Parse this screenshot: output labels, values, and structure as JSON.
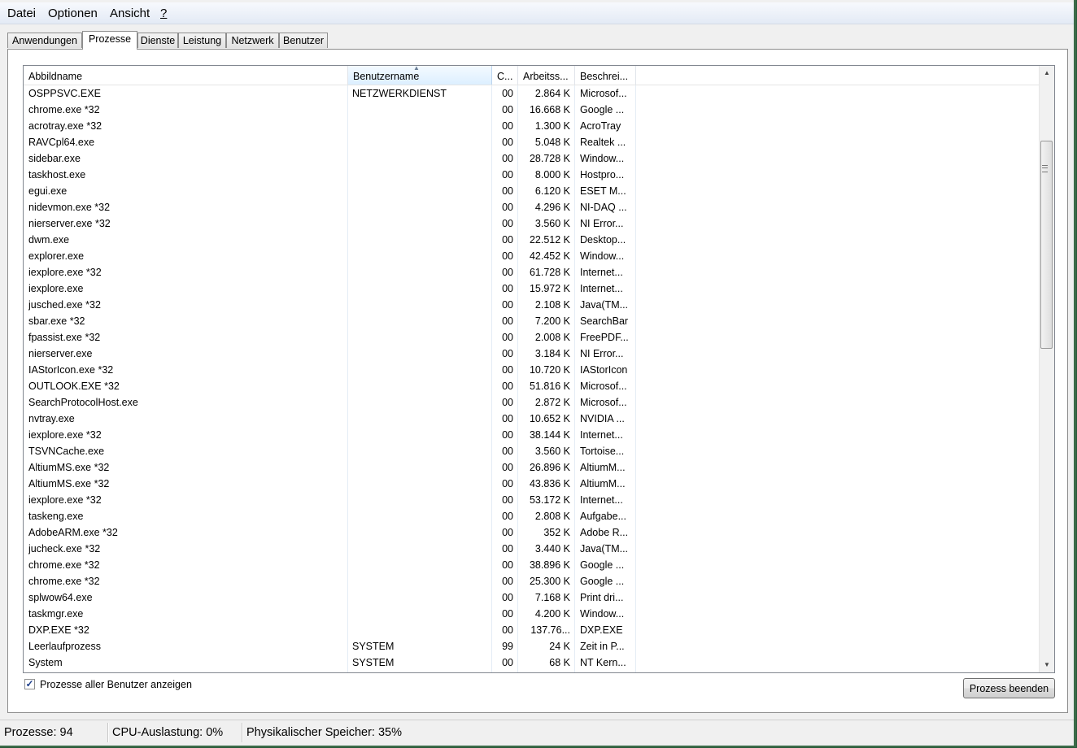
{
  "menu": [
    {
      "label": "Datei"
    },
    {
      "label": "Optionen"
    },
    {
      "label": "Ansicht"
    },
    {
      "label": "?"
    }
  ],
  "tabs": [
    {
      "label": "Anwendungen"
    },
    {
      "label": "Prozesse"
    },
    {
      "label": "Dienste"
    },
    {
      "label": "Leistung"
    },
    {
      "label": "Netzwerk"
    },
    {
      "label": "Benutzer"
    }
  ],
  "active_tab": "Prozesse",
  "columns": [
    {
      "label": "Abbildname"
    },
    {
      "label": "Benutzername"
    },
    {
      "label": "C..."
    },
    {
      "label": "Arbeitss..."
    },
    {
      "label": "Beschrei..."
    }
  ],
  "sorted_column": "Benutzername",
  "processes": [
    [
      "OSPPSVC.EXE",
      "NETZWERKDIENST",
      "00",
      "2.864 K",
      "Microsof..."
    ],
    [
      "chrome.exe *32",
      "",
      "00",
      "16.668 K",
      "Google ..."
    ],
    [
      "acrotray.exe *32",
      "",
      "00",
      "1.300 K",
      "AcroTray"
    ],
    [
      "RAVCpl64.exe",
      "",
      "00",
      "5.048 K",
      "Realtek ..."
    ],
    [
      "sidebar.exe",
      "",
      "00",
      "28.728 K",
      "Window..."
    ],
    [
      "taskhost.exe",
      "",
      "00",
      "8.000 K",
      "Hostpro..."
    ],
    [
      "egui.exe",
      "",
      "00",
      "6.120 K",
      "ESET M..."
    ],
    [
      "nidevmon.exe *32",
      "",
      "00",
      "4.296 K",
      "NI-DAQ ..."
    ],
    [
      "nierserver.exe *32",
      "",
      "00",
      "3.560 K",
      "NI Error..."
    ],
    [
      "dwm.exe",
      "",
      "00",
      "22.512 K",
      "Desktop..."
    ],
    [
      "explorer.exe",
      "",
      "00",
      "42.452 K",
      "Window..."
    ],
    [
      "iexplore.exe *32",
      "",
      "00",
      "61.728 K",
      "Internet..."
    ],
    [
      "iexplore.exe",
      "",
      "00",
      "15.972 K",
      "Internet..."
    ],
    [
      "jusched.exe *32",
      "",
      "00",
      "2.108 K",
      "Java(TM..."
    ],
    [
      "sbar.exe *32",
      "",
      "00",
      "7.200 K",
      "SearchBar"
    ],
    [
      "fpassist.exe *32",
      "",
      "00",
      "2.008 K",
      "FreePDF..."
    ],
    [
      "nierserver.exe",
      "",
      "00",
      "3.184 K",
      "NI Error..."
    ],
    [
      "IAStorIcon.exe *32",
      "",
      "00",
      "10.720 K",
      "IAStorIcon"
    ],
    [
      "OUTLOOK.EXE *32",
      "",
      "00",
      "51.816 K",
      "Microsof..."
    ],
    [
      "SearchProtocolHost.exe",
      "",
      "00",
      "2.872 K",
      "Microsof..."
    ],
    [
      "nvtray.exe",
      "",
      "00",
      "10.652 K",
      "NVIDIA ..."
    ],
    [
      "iexplore.exe *32",
      "",
      "00",
      "38.144 K",
      "Internet..."
    ],
    [
      "TSVNCache.exe",
      "",
      "00",
      "3.560 K",
      "Tortoise..."
    ],
    [
      "AltiumMS.exe *32",
      "",
      "00",
      "26.896 K",
      "AltiumM..."
    ],
    [
      "AltiumMS.exe *32",
      "",
      "00",
      "43.836 K",
      "AltiumM..."
    ],
    [
      "iexplore.exe *32",
      "",
      "00",
      "53.172 K",
      "Internet..."
    ],
    [
      "taskeng.exe",
      "",
      "00",
      "2.808 K",
      "Aufgabe..."
    ],
    [
      "AdobeARM.exe *32",
      "",
      "00",
      "352 K",
      "Adobe R..."
    ],
    [
      "jucheck.exe *32",
      "",
      "00",
      "3.440 K",
      "Java(TM..."
    ],
    [
      "chrome.exe *32",
      "",
      "00",
      "38.896 K",
      "Google ..."
    ],
    [
      "chrome.exe *32",
      "",
      "00",
      "25.300 K",
      "Google ..."
    ],
    [
      "splwow64.exe",
      "",
      "00",
      "7.168 K",
      "Print dri..."
    ],
    [
      "taskmgr.exe",
      "",
      "00",
      "4.200 K",
      "Window..."
    ],
    [
      "DXP.EXE *32",
      "",
      "00",
      "137.76...",
      "DXP.EXE"
    ],
    [
      "Leerlaufprozess",
      "SYSTEM",
      "99",
      "24 K",
      "Zeit in P..."
    ],
    [
      "System",
      "SYSTEM",
      "00",
      "68 K",
      "NT Kern..."
    ]
  ],
  "show_all_users": {
    "label": "Prozesse aller Benutzer anzeigen",
    "checked": true
  },
  "end_process_button": {
    "label": "Prozess beenden"
  },
  "status": {
    "processes": "Prozesse: 94",
    "cpu": "CPU-Auslastung: 0%",
    "memory": "Physikalischer Speicher: 35%"
  },
  "scroll_position_fraction": 0.15
}
